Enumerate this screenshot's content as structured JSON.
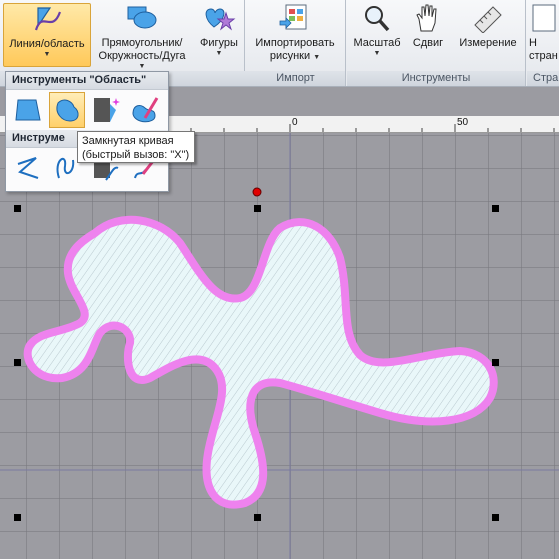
{
  "ribbon": {
    "groups": [
      {
        "title": "",
        "buttons": [
          {
            "label": "Линия/область",
            "icon": "line-area-icon",
            "active": true
          },
          {
            "label_line1": "Прямоугольник/",
            "label_line2": "Окружность/Дуга",
            "icon": "shapes-icon"
          },
          {
            "label": "Фигуры",
            "icon": "figures-icon"
          }
        ]
      },
      {
        "title": "Импорт",
        "buttons": [
          {
            "label_line1": "Импортировать",
            "label_line2": "рисунки",
            "icon": "import-pictures-icon"
          }
        ]
      },
      {
        "title": "Инструменты",
        "buttons": [
          {
            "label": "Масштаб",
            "icon": "magnifier-icon"
          },
          {
            "label": "Сдвиг",
            "icon": "hand-icon"
          },
          {
            "label": "Измерение",
            "icon": "ruler-icon"
          }
        ]
      },
      {
        "title": "Стра",
        "buttons": [
          {
            "label_line1": "Н",
            "label_line2": "стран",
            "icon": "page-icon"
          }
        ]
      }
    ]
  },
  "panel": {
    "title_area": "Инструменты \"Область\"",
    "title_lines": "Инструме",
    "area_tools": [
      "polygon-area-icon",
      "closed-curve-icon",
      "magic-fill-icon",
      "freehand-area-icon"
    ],
    "line_tools": [
      "polyline-icon",
      "curve-icon",
      "fill-bucket-icon",
      "pencil-icon"
    ]
  },
  "tooltip": {
    "line1": "Замкнутая кривая",
    "line2": "(быстрый вызов: \"X\")"
  },
  "ruler": {
    "labels": [
      "0",
      "50"
    ]
  },
  "colors": {
    "accent": "#ffc95a",
    "shape_fill": "#e6f6f8",
    "shape_outline": "#ee82ee",
    "rotate_handle": "#e00000",
    "canvas": "#9c9ca2"
  }
}
